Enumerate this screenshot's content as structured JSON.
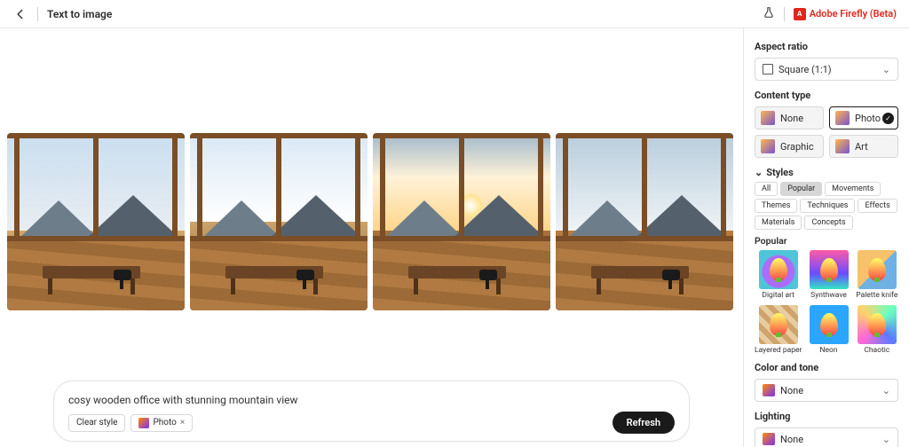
{
  "header": {
    "title": "Text to image",
    "brand": "Adobe Firefly (Beta)"
  },
  "prompt": {
    "text": "cosy wooden office with stunning mountain view",
    "clear_label": "Clear style",
    "chip_label": "Photo",
    "refresh_label": "Refresh"
  },
  "aspect_ratio": {
    "label": "Aspect ratio",
    "value": "Square (1:1)"
  },
  "content_type": {
    "label": "Content type",
    "options": [
      {
        "label": "None"
      },
      {
        "label": "Photo",
        "selected": true
      },
      {
        "label": "Graphic"
      },
      {
        "label": "Art"
      }
    ]
  },
  "styles": {
    "label": "Styles",
    "tabs": [
      "All",
      "Popular",
      "Movements",
      "Themes",
      "Techniques",
      "Effects",
      "Materials",
      "Concepts"
    ],
    "active_tab": "Popular",
    "group_label": "Popular",
    "items": [
      {
        "label": "Digital art"
      },
      {
        "label": "Synthwave"
      },
      {
        "label": "Palette knife"
      },
      {
        "label": "Layered paper"
      },
      {
        "label": "Neon"
      },
      {
        "label": "Chaotic"
      }
    ]
  },
  "color_tone": {
    "label": "Color and tone",
    "value": "None"
  },
  "lighting": {
    "label": "Lighting",
    "value": "None"
  }
}
